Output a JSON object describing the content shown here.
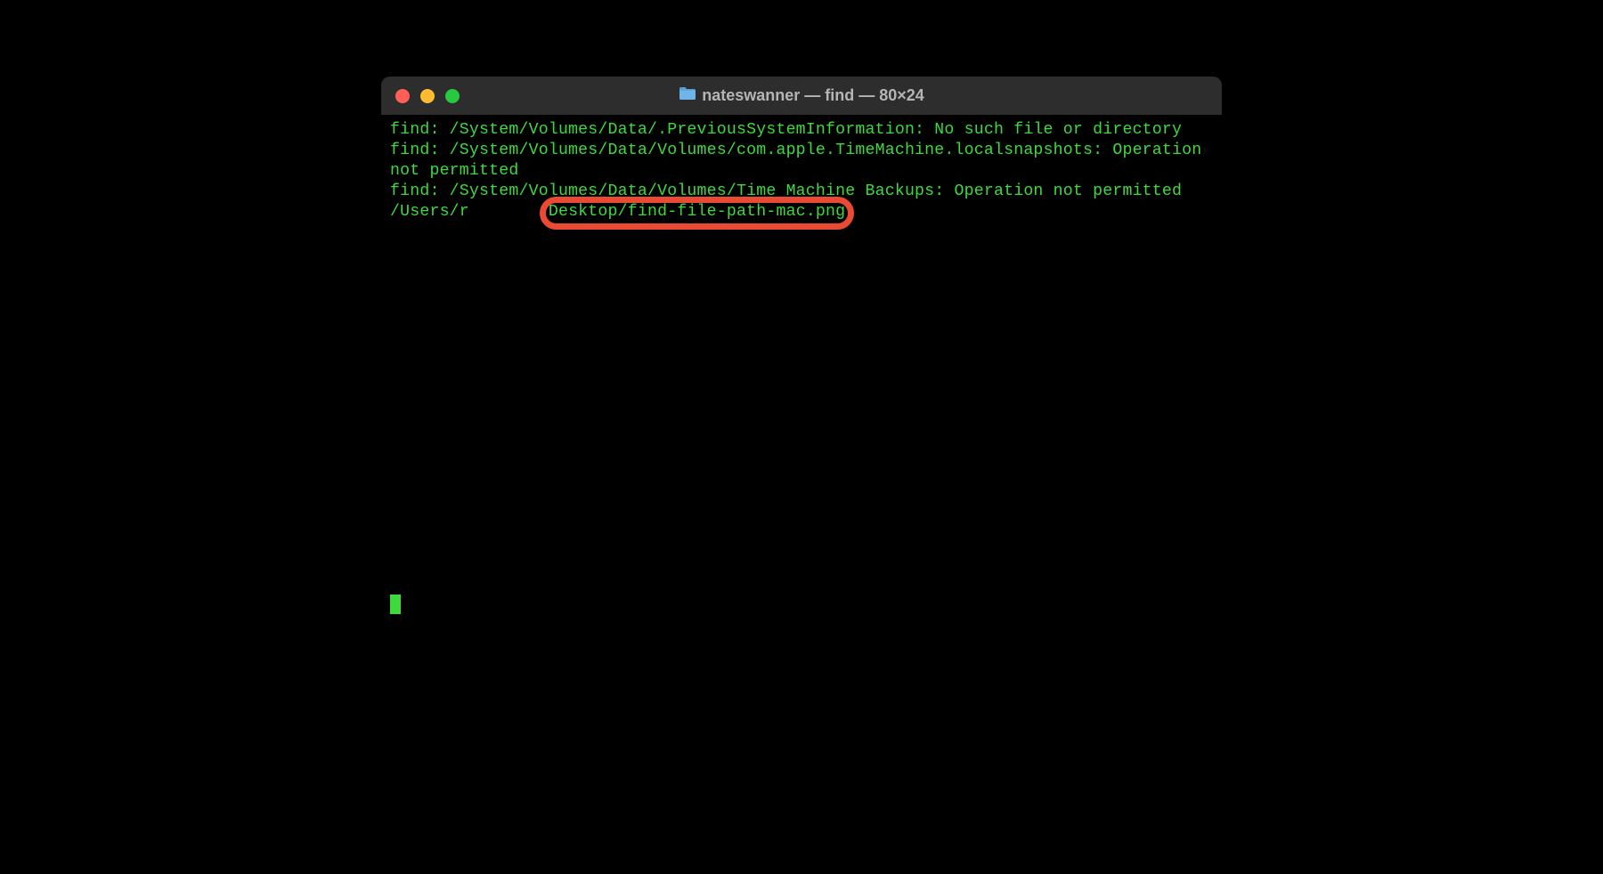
{
  "window": {
    "title": "nateswanner — find — 80×24",
    "traffic_lights": {
      "close": "#ff5f57",
      "minimize": "#febc2e",
      "zoom": "#28c840"
    }
  },
  "terminal": {
    "lines": {
      "l1": "find: /System/Volumes/Data/.PreviousSystemInformation: No such file or directory",
      "l2": "find: /System/Volumes/Data/Volumes/com.apple.TimeMachine.localsnapshots: Operation not permitted",
      "l3": "find: /System/Volumes/Data/Volumes/Time Machine Backups: Operation not permitted",
      "l4_prefix": "/Users/r",
      "l4_gap": "        ",
      "l4_highlight": "Desktop/find-file-path-mac.png"
    },
    "text_color": "#3dd93d",
    "highlight_border_color": "#e84a33"
  }
}
